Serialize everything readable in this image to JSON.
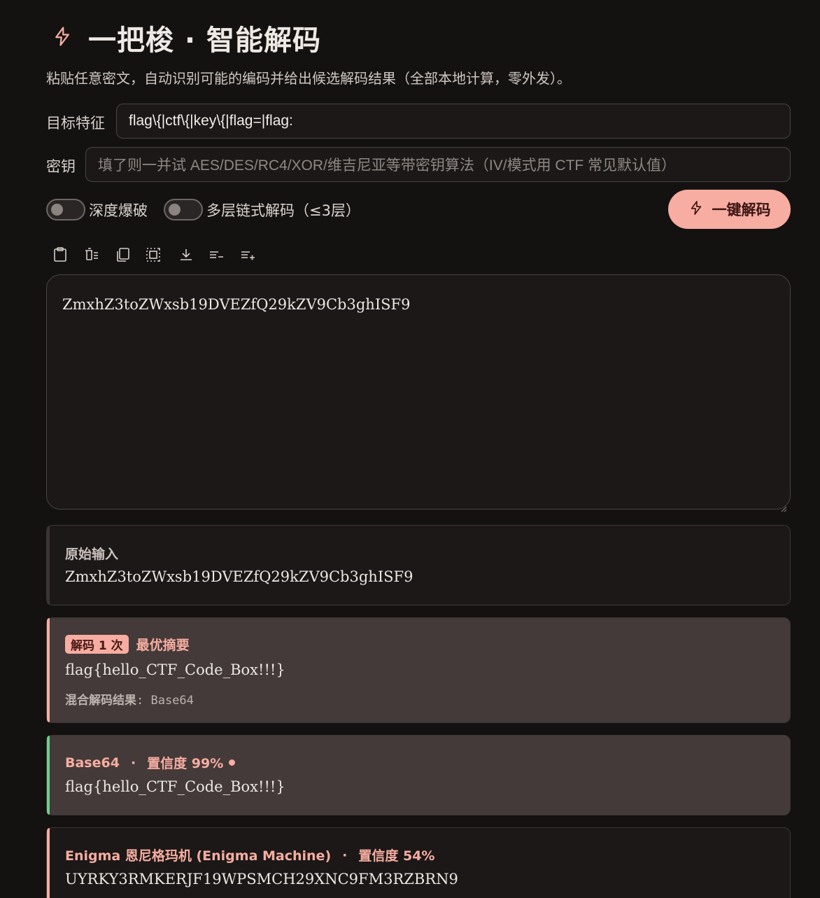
{
  "header": {
    "title": "一把梭 · 智能解码",
    "subtitle": "粘贴任意密文，自动识别可能的编码并给出候选解码结果（全部本地计算，零外发）。"
  },
  "target": {
    "label": "目标特征",
    "value": "flag\\{|ctf\\{|key\\{|flag=|flag:"
  },
  "key": {
    "label": "密钥",
    "placeholder": "填了则一并试 AES/DES/RC4/XOR/维吉尼亚等带密钥算法（IV/模式用 CTF 常见默认值）"
  },
  "options": {
    "deep_brute": {
      "label": "深度爆破",
      "on": false
    },
    "chain_decode": {
      "label": "多层链式解码（≤3层）",
      "on": false
    }
  },
  "decode_button": {
    "label": "一键解码"
  },
  "toolbar": [
    "clipboard-paste-icon",
    "clear-icon",
    "copy-icon",
    "select-all-icon",
    "download-icon",
    "collapse-icon",
    "expand-icon"
  ],
  "editor": {
    "value": "ZmxhZ3toZWxsb19DVEZfQ29kZV9Cb3ghISF9"
  },
  "cards": {
    "original": {
      "title": "原始输入",
      "value": "ZmxhZ3toZWxsb19DVEZfQ29kZV9Cb3ghISF9"
    },
    "summary": {
      "badge": "解码 1 次",
      "title": "最优摘要",
      "value": "flag{hello_CTF_Code_Box!!!}",
      "meta_key": "混合解码结果",
      "meta_value": ": Base64"
    },
    "base64": {
      "name": "Base64",
      "sep": "·",
      "confidence": "置信度 99%",
      "value": "flag{hello_CTF_Code_Box!!!}"
    },
    "enigma": {
      "name": "Enigma 恩尼格玛机 (Enigma Machine)",
      "sep": "·",
      "confidence": "置信度 54%",
      "value": "UYRKY3RMKERJF19WPSMCH29XNC9FM3RZBRN9"
    }
  },
  "colors": {
    "accent": "#f7ada1",
    "success": "#6fcf8a",
    "background": "#141211"
  }
}
